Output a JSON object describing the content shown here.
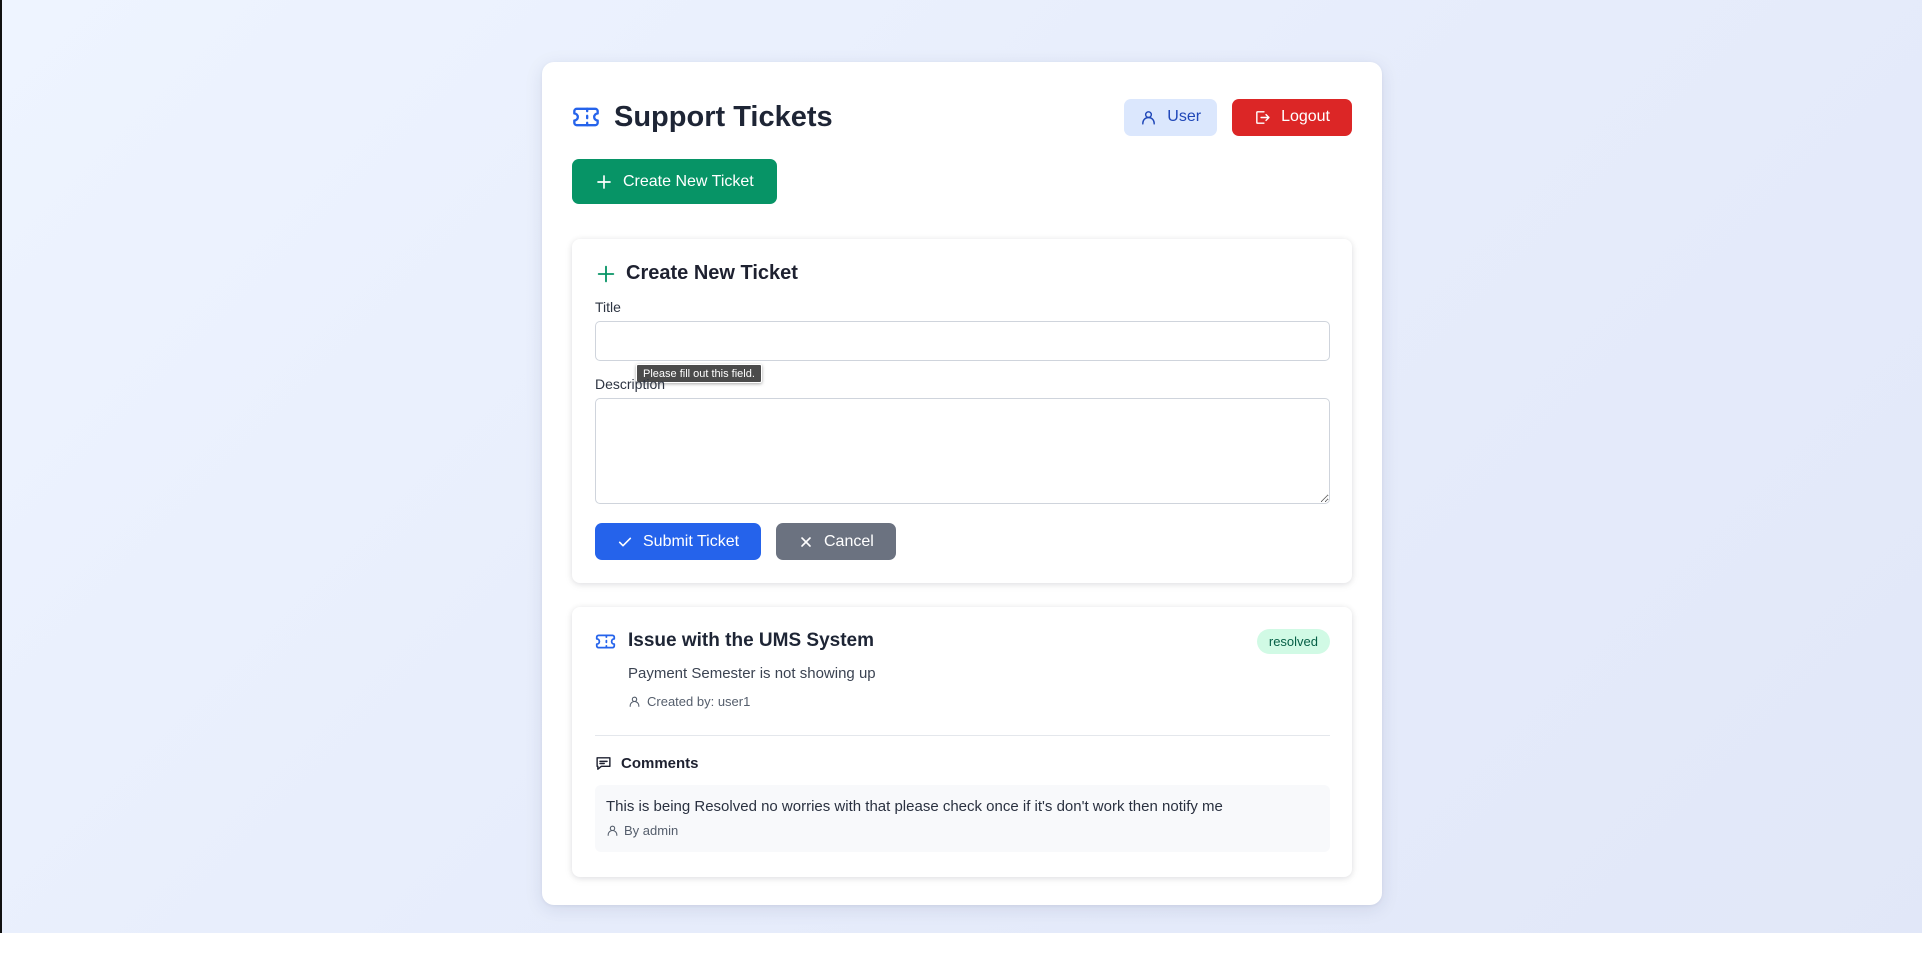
{
  "header": {
    "title": "Support Tickets",
    "title_icon": "ticket-icon",
    "user_label": "User",
    "logout_label": "Logout"
  },
  "create_button_label": "Create New Ticket",
  "form": {
    "heading": "Create New Ticket",
    "title_label": "Title",
    "title_value": "",
    "validation_tooltip": "Please fill out this field.",
    "description_label": "Description",
    "description_value": "",
    "submit_label": "Submit Ticket",
    "cancel_label": "Cancel"
  },
  "tickets": [
    {
      "title": "Issue with the UMS System",
      "status": "resolved",
      "description": "Payment Semester is not showing up",
      "created_by": "Created by: user1",
      "comments_heading": "Comments",
      "comments": [
        {
          "text": "This is being Resolved no worries with that please check once if it's don't work then notify me",
          "author": "By admin"
        }
      ]
    }
  ],
  "colors": {
    "accent_blue": "#2563eb",
    "create_green": "#079466",
    "logout_red": "#dc2626",
    "cancel_gray": "#6b7280",
    "resolved_badge_bg": "#d1fae5",
    "resolved_badge_text": "#065f46"
  }
}
